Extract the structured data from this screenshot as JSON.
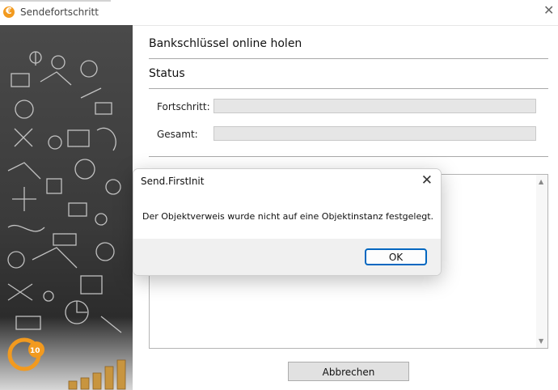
{
  "window": {
    "title": "Sendefortschritt",
    "icon": "euro-coin-icon"
  },
  "main": {
    "heading": "Bankschlüssel online holen",
    "status_title": "Status",
    "progress_label": "Fortschritt:",
    "progress_value": 0,
    "total_label": "Gesamt:",
    "total_value": 0,
    "cancel_label": "Abbrechen"
  },
  "side_panel": {
    "logo_text": "10"
  },
  "dialog": {
    "title": "Send.FirstInit",
    "message": "Der Objektverweis wurde nicht auf eine Objektinstanz festgelegt.",
    "ok_label": "OK"
  }
}
